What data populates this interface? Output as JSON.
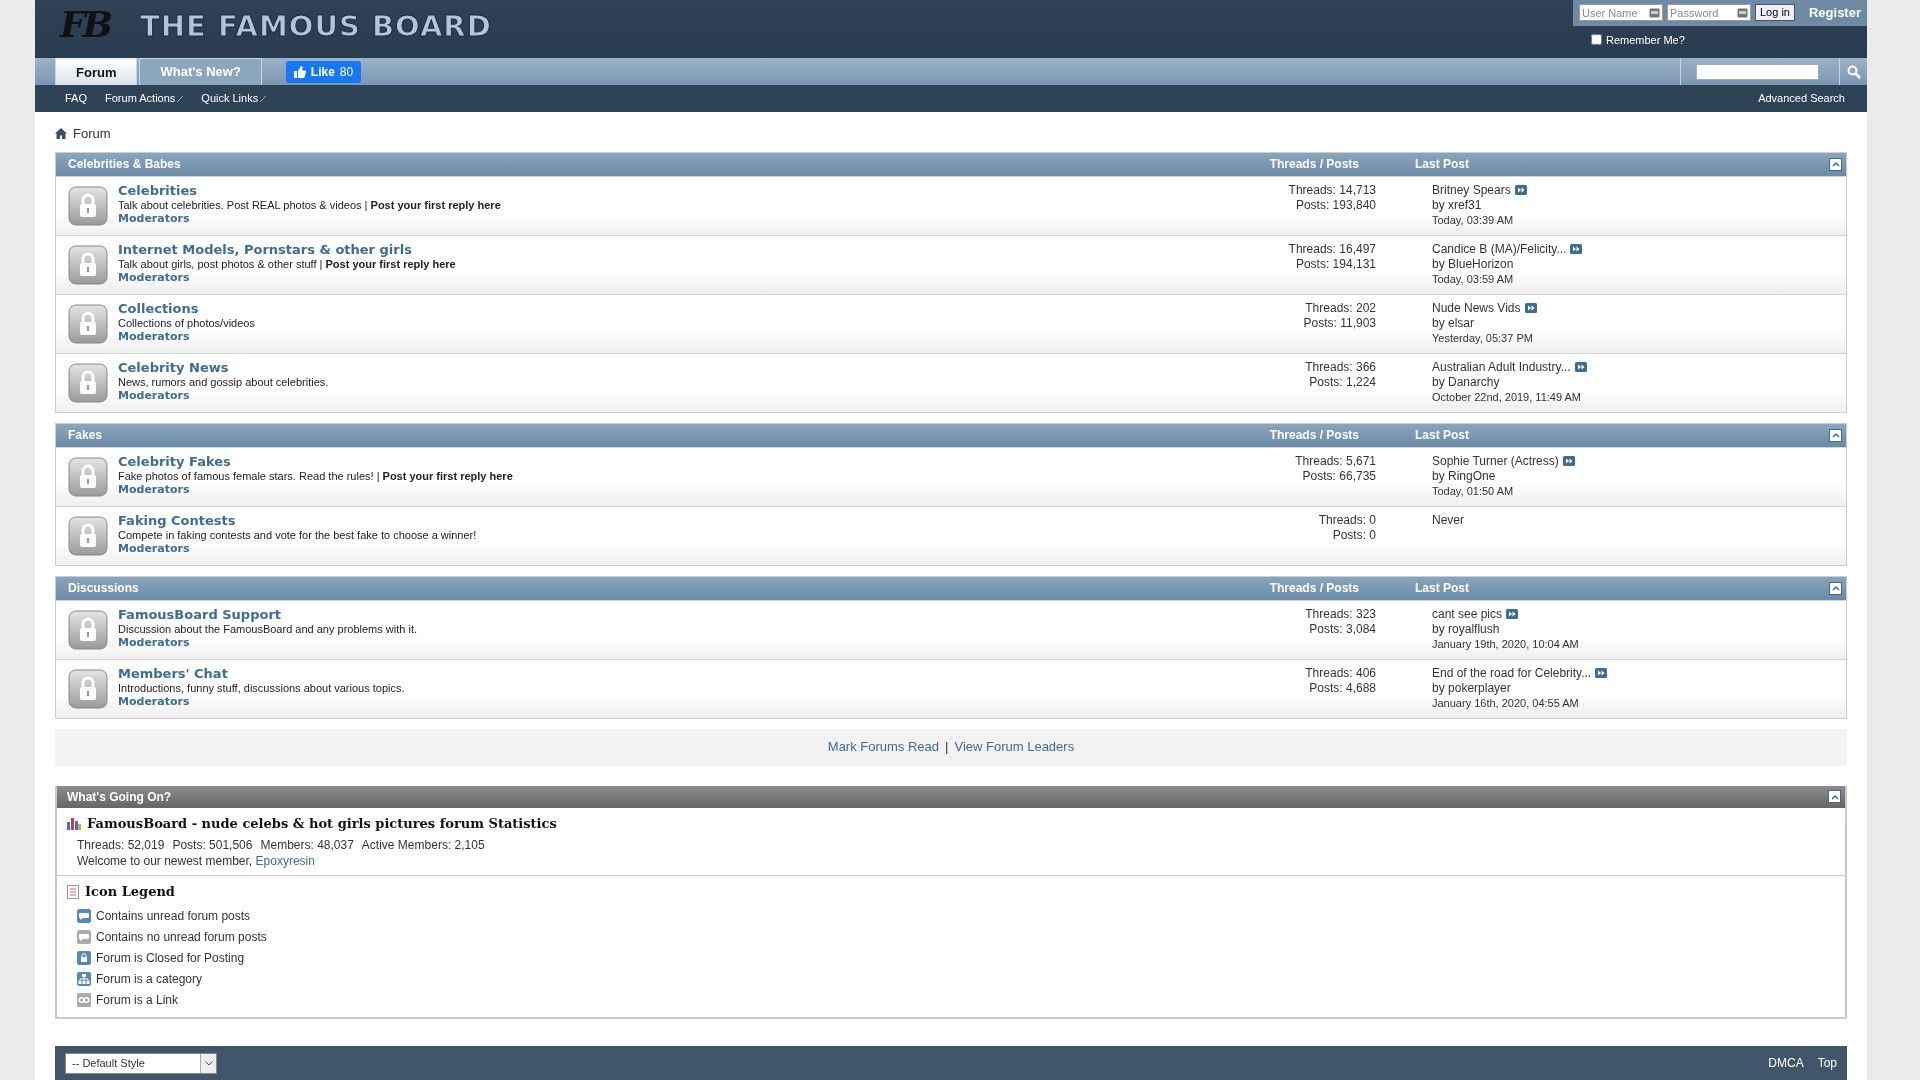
{
  "header": {
    "logo_monogram": "FB",
    "site_title": "THE FAMOUS BOARD"
  },
  "login": {
    "username_placeholder": "User Name",
    "password_placeholder": "Password",
    "button": "Log in",
    "register": "Register",
    "remember_label": "Remember Me?",
    "remember_checked": false
  },
  "tabs": [
    {
      "label": "Forum",
      "selected": true
    },
    {
      "label": "What's New?",
      "selected": false
    }
  ],
  "like_button": {
    "label": "Like",
    "count": "80"
  },
  "subnav": [
    {
      "label": "FAQ",
      "dropdown": false
    },
    {
      "label": "Forum Actions",
      "dropdown": true
    },
    {
      "label": "Quick Links",
      "dropdown": true
    }
  ],
  "advanced_search": "Advanced Search",
  "breadcrumb": "Forum",
  "categories": [
    {
      "title": "Celebrities & Babes",
      "columns": [
        "Threads / Posts",
        "Last Post"
      ],
      "expanded": true,
      "forums": [
        {
          "name": "Celebrities",
          "description": "Talk about celebrities. Post REAL photos & videos",
          "reply_link": "Post your first reply here",
          "moderators": "Moderators",
          "threads": "Threads: 14,713",
          "posts": "Posts: 193,840",
          "last_post": {
            "kind": "post",
            "title": "Britney Spears",
            "by": "by",
            "user": "xref31",
            "time": "Today, 03:39 AM"
          }
        },
        {
          "name": "Internet Models, Pornstars & other girls",
          "description": "Talk about girls, post photos & other stuff",
          "reply_link": "Post your first reply here",
          "moderators": "Moderators",
          "threads": "Threads: 16,497",
          "posts": "Posts: 194,131",
          "last_post": {
            "kind": "post",
            "title": "Candice B (MA)/Felicity...",
            "by": "by",
            "user": "BlueHorizon",
            "time": "Today, 03:59 AM"
          }
        },
        {
          "name": "Collections",
          "description": "Collections of photos/videos",
          "moderators": "Moderators",
          "threads": "Threads: 202",
          "posts": "Posts: 11,903",
          "last_post": {
            "kind": "post",
            "title": "Nude News Vids",
            "by": "by",
            "user": "elsar",
            "time": "Yesterday, 05:37 PM"
          }
        },
        {
          "name": "Celebrity News",
          "description": "News, rumors and gossip about celebrities.",
          "moderators": "Moderators",
          "threads": "Threads: 366",
          "posts": "Posts: 1,224",
          "last_post": {
            "kind": "post",
            "title": "Australian Adult Industry...",
            "by": "by",
            "user": "Danarchy",
            "time": "October 22nd, 2019, 11:49 AM"
          }
        }
      ]
    },
    {
      "title": "Fakes",
      "columns": [
        "Threads / Posts",
        "Last Post"
      ],
      "expanded": true,
      "forums": [
        {
          "name": "Celebrity Fakes",
          "description": "Fake photos of famous female stars. Read the rules!",
          "reply_link": "Post your first reply here",
          "moderators": "Moderators",
          "threads": "Threads: 5,671",
          "posts": "Posts: 66,735",
          "last_post": {
            "kind": "post",
            "title": "Sophie Turner (Actress)",
            "by": "by",
            "user": "RingOne",
            "time": "Today, 01:50 AM"
          }
        },
        {
          "name": "Faking Contests",
          "description": "Compete in faking contests and vote for the best fake to choose a winner!",
          "moderators": "Moderators",
          "threads": "Threads: 0",
          "posts": "Posts: 0",
          "last_post": {
            "kind": "none",
            "text": "Never"
          }
        }
      ]
    },
    {
      "title": "Discussions",
      "columns": [
        "Threads / Posts",
        "Last Post"
      ],
      "expanded": true,
      "forums": [
        {
          "name": "FamousBoard Support",
          "description": "Discussion about the FamousBoard and any problems with it.",
          "moderators": "Moderators",
          "threads": "Threads: 323",
          "posts": "Posts: 3,084",
          "last_post": {
            "kind": "post",
            "title": "cant see pics",
            "by": "by",
            "user": "royalflush",
            "time": "January 19th, 2020, 10:04 AM"
          }
        },
        {
          "name": "Members' Chat",
          "description": "Introductions, funny stuff, discussions about various topics.",
          "moderators": "Moderators",
          "threads": "Threads: 406",
          "posts": "Posts: 4,688",
          "last_post": {
            "kind": "post",
            "title": "End of the road for Celebrity...",
            "by": "by",
            "user": "pokerplayer",
            "time": "January 16th, 2020, 04:55 AM"
          }
        }
      ]
    }
  ],
  "forum_links": [
    "Mark Forums Read",
    "View Forum Leaders"
  ],
  "forum_links_separator": "|",
  "reply_separator": "|",
  "whats_going_on": {
    "title": "What's Going On?",
    "expanded": true,
    "stats_title": "FamousBoard - nude celebs & hot girls pictures forum Statistics",
    "stats": [
      "Threads: 52,019",
      "Posts: 501,506",
      "Members: 48,037",
      "Active Members: 2,105"
    ],
    "welcome": "Welcome to our newest member,",
    "newest_member": "Epoxyresin",
    "legend_title": "Icon Legend",
    "legend": [
      {
        "kind": "unread",
        "label": "Contains unread forum posts"
      },
      {
        "kind": "read",
        "label": "Contains no unread forum posts"
      },
      {
        "kind": "closed",
        "label": "Forum is Closed for Posting"
      },
      {
        "kind": "category",
        "label": "Forum is a category"
      },
      {
        "kind": "link",
        "label": "Forum is a Link"
      }
    ]
  },
  "style_select": "-- Default Style",
  "footer_links": [
    "DMCA",
    "Top"
  ]
}
